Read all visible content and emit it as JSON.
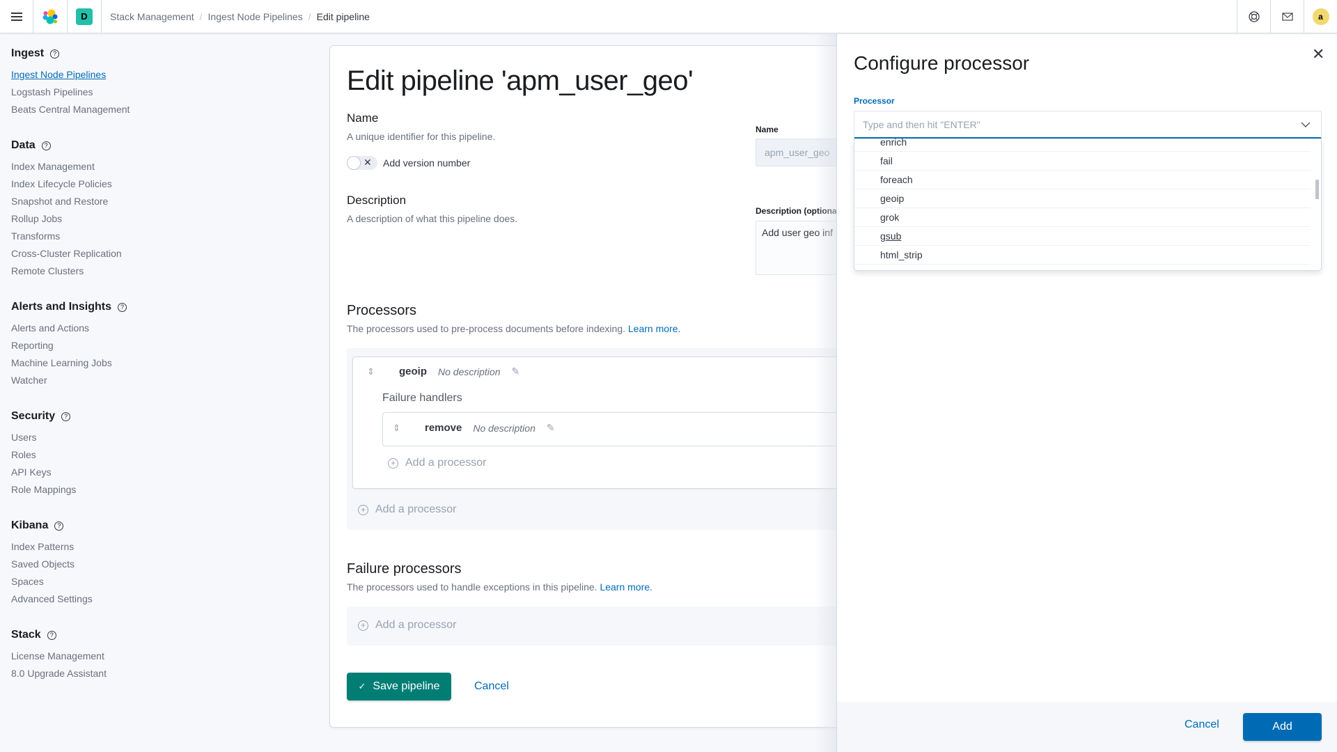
{
  "header": {
    "space_badge": "D",
    "breadcrumbs": [
      "Stack Management",
      "Ingest Node Pipelines",
      "Edit pipeline"
    ],
    "avatar_initial": "a",
    "icons": [
      "menu-icon",
      "elastic-logo",
      "help-icon",
      "newsfeed-icon"
    ]
  },
  "sidebar": {
    "groups": [
      {
        "title": "Ingest",
        "items": [
          "Ingest Node Pipelines",
          "Logstash Pipelines",
          "Beats Central Management"
        ]
      },
      {
        "title": "Data",
        "items": [
          "Index Management",
          "Index Lifecycle Policies",
          "Snapshot and Restore",
          "Rollup Jobs",
          "Transforms",
          "Cross-Cluster Replication",
          "Remote Clusters"
        ]
      },
      {
        "title": "Alerts and Insights",
        "items": [
          "Alerts and Actions",
          "Reporting",
          "Machine Learning Jobs",
          "Watcher"
        ]
      },
      {
        "title": "Security",
        "items": [
          "Users",
          "Roles",
          "API Keys",
          "Role Mappings"
        ]
      },
      {
        "title": "Kibana",
        "items": [
          "Index Patterns",
          "Saved Objects",
          "Spaces",
          "Advanced Settings"
        ]
      },
      {
        "title": "Stack",
        "items": [
          "License Management",
          "8.0 Upgrade Assistant"
        ]
      }
    ],
    "active_item": "Ingest Node Pipelines"
  },
  "main": {
    "title": "Edit pipeline 'apm_user_geo'",
    "name_section": {
      "title": "Name",
      "description": "A unique identifier for this pipeline.",
      "toggle_label": "Add version number",
      "toggle_on": false,
      "field_label": "Name",
      "field_value": "apm_user_geo"
    },
    "description_section": {
      "title": "Description",
      "description": "A description of what this pipeline does.",
      "field_label": "Description (optiona",
      "field_value": "Add user geo inf"
    },
    "processors": {
      "title": "Processors",
      "description": "The processors used to pre-process documents before indexing.",
      "learn_more": "Learn more.",
      "items": [
        {
          "name": "geoip",
          "description": "No description",
          "failure_handlers_label": "Failure handlers",
          "failure_handlers": [
            {
              "name": "remove",
              "description": "No description"
            }
          ],
          "add_label": "Add a processor"
        }
      ],
      "add_label": "Add a processor"
    },
    "failure_processors": {
      "title": "Failure processors",
      "description": "The processors used to handle exceptions in this pipeline.",
      "learn_more": "Learn more.",
      "add_label": "Add a processor"
    },
    "save_label": "Save pipeline",
    "cancel_label": "Cancel"
  },
  "flyout": {
    "title": "Configure processor",
    "processor_label": "Processor",
    "combo_placeholder": "Type and then hit \"ENTER\"",
    "options": [
      "enrich",
      "fail",
      "foreach",
      "geoip",
      "grok",
      "gsub",
      "html_strip"
    ],
    "hovered_option": "gsub",
    "cancel_label": "Cancel",
    "add_label": "Add"
  },
  "colors": {
    "primary": "#006bb4",
    "secondary": "#017d73",
    "space_badge": "#24bfa8",
    "avatar": "#f1d86f"
  }
}
